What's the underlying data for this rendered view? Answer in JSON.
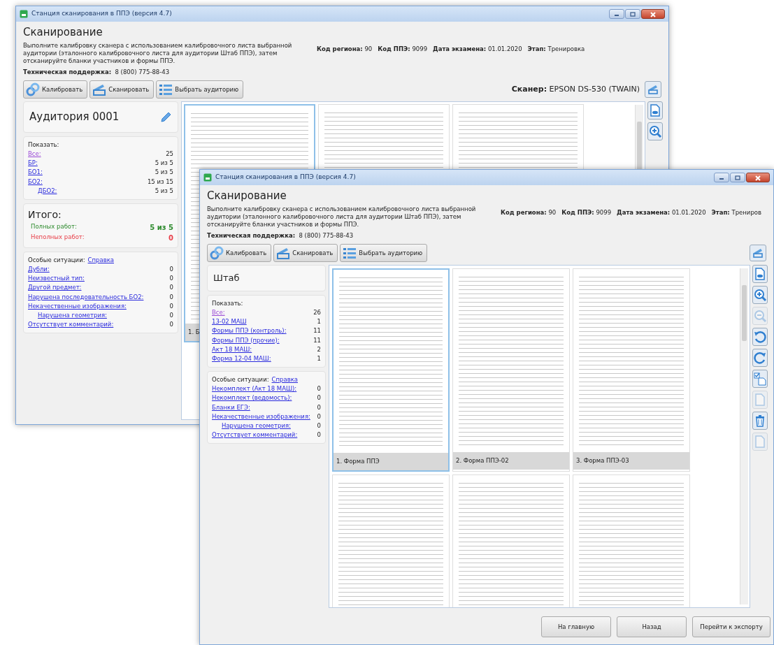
{
  "windows": [
    {
      "title": "Станция сканирования в ППЭ (версия 4.7)",
      "heading": "Сканирование",
      "description": "Выполните калибровку сканера с использованием калибровочного листа выбранной аудитории (эталонного калибровочного листа для аудитории Штаб ППЭ), затем отсканируйте бланки участников и формы ППЭ.",
      "info": [
        "**Код региона:** 90",
        "**Код ППЭ:** 9099",
        "**Дата экзамена:** 01.01.2020",
        "**Этап:** Тренировка"
      ],
      "support": "**Техническая поддержка:**  8 (800) 775-88-43",
      "toolbar": [
        {
          "kind": "calibrate",
          "label": "Калибровать"
        },
        {
          "kind": "scan",
          "label": "Сканировать"
        },
        {
          "kind": "list",
          "label": "Выбрать аудиторию"
        }
      ],
      "scanner": "**Сканер:** EPSON DS-530 (TWAIN)",
      "room": {
        "name": "Аудитория 0001",
        "editable": true
      },
      "show": {
        "label": "Показать:",
        "items": [
          {
            "label": "Все:",
            "value": "25",
            "visited": true
          },
          {
            "label": "БР:",
            "value": "5 из 5",
            "visited": false
          },
          {
            "label": "БО1:",
            "value": "5 из 5",
            "visited": false
          },
          {
            "label": "БО2:",
            "value": "15 из 15",
            "visited": false,
            "children": [
              {
                "label": "ДБО2:",
                "value": "5 из 5",
                "visited": false
              }
            ]
          }
        ]
      },
      "totals": {
        "heading": "Итого:",
        "items": [
          {
            "label": "Полных работ:",
            "value": "5 из 5",
            "color": "#2e8b2e"
          },
          {
            "label": "Неполных работ:",
            "value": "0",
            "color": "#e8404a"
          }
        ]
      },
      "special": {
        "label": "Особые ситуации:",
        "help": "Справка",
        "items": [
          {
            "label": "Дубли:",
            "value": "0"
          },
          {
            "label": "Неизвестный тип:",
            "value": "0"
          },
          {
            "label": "Другой предмет:",
            "value": "0"
          },
          {
            "label": "Нарушена последовательность БО2:",
            "value": "0"
          },
          {
            "label": "Некачественные изображения:",
            "value": "0",
            "children": [
              {
                "label": "Нарушена геометрия:",
                "value": "0"
              }
            ]
          },
          {
            "label": "Отсутствует комментарий:",
            "value": "0"
          }
        ]
      },
      "thumbnails": [
        {
          "caption": "1. Б",
          "selected": true
        },
        {
          "selected": false
        },
        {
          "selected": false
        }
      ],
      "side_tools": [
        {
          "kind": "view",
          "disabled": false
        },
        {
          "kind": "zoom-in",
          "disabled": false
        }
      ]
    },
    {
      "title": "Станция сканирования в ППЭ (версия 4.7)",
      "heading": "Сканирование",
      "description": "Выполните калибровку сканера с использованием калибровочного листа выбранной аудитории (эталонного калибровочного листа для аудитории Штаб ППЭ), затем отсканируйте бланки участников и формы ППЭ.",
      "info": [
        "**Код региона:** 90",
        "**Код ППЭ:** 9099",
        "**Дата экзамена:** 01.01.2020",
        "**Этап:** Трениров"
      ],
      "support": "**Техническая поддержка:**  8 (800) 775-88-43",
      "toolbar": [
        {
          "kind": "calibrate",
          "label": "Калибровать"
        },
        {
          "kind": "scan",
          "label": "Сканировать"
        },
        {
          "kind": "list",
          "label": "Выбрать аудиторию"
        }
      ],
      "room": {
        "name": "Штаб",
        "editable": false
      },
      "show": {
        "label": "Показать:",
        "items": [
          {
            "label": "Все:",
            "value": "26",
            "visited": true
          },
          {
            "label": "13-02 МАШ",
            "value": "1",
            "visited": false
          },
          {
            "label": "Формы ППЭ (контроль):",
            "value": "11",
            "visited": false
          },
          {
            "label": "Формы ППЭ (прочие):",
            "value": "11",
            "visited": false
          },
          {
            "label": "Акт 18 МАШ:",
            "value": "2",
            "visited": false
          },
          {
            "label": "Форма 12-04 МАШ:",
            "value": "1",
            "visited": false
          }
        ]
      },
      "special": {
        "label": "Особые ситуации:",
        "help": "Справка",
        "items": [
          {
            "label": "Некомплект (Акт 18 МАШ):",
            "value": "0"
          },
          {
            "label": "Некомплект (ведомость):",
            "value": "0"
          },
          {
            "label": "Бланки ЕГЭ:",
            "value": "0"
          },
          {
            "label": "Некачественные изображения:",
            "value": "0",
            "children": [
              {
                "label": "Нарушена геометрия:",
                "value": "0"
              }
            ]
          },
          {
            "label": "Отсутствует комментарий:",
            "value": "0"
          }
        ]
      },
      "thumbnails": [
        {
          "caption": "1. Форма ППЭ",
          "selected": true
        },
        {
          "caption": "2. Форма ППЭ-02",
          "selected": false
        },
        {
          "caption": "3. Форма ППЭ-03",
          "selected": false
        },
        {
          "selected": false
        },
        {
          "selected": false
        },
        {
          "selected": false
        }
      ],
      "side_tools": [
        {
          "kind": "view",
          "disabled": false
        },
        {
          "kind": "zoom-in",
          "disabled": false
        },
        {
          "kind": "zoom-out",
          "disabled": true
        },
        {
          "kind": "rotate-left",
          "disabled": false
        },
        {
          "kind": "rotate-right",
          "disabled": false
        },
        {
          "kind": "check",
          "disabled": false
        },
        {
          "kind": "page",
          "disabled": true
        },
        {
          "kind": "trash",
          "disabled": false
        },
        {
          "kind": "page",
          "disabled": true
        }
      ],
      "footer_buttons": [
        "На главную",
        "Назад",
        "Перейти к экспорту"
      ]
    }
  ]
}
